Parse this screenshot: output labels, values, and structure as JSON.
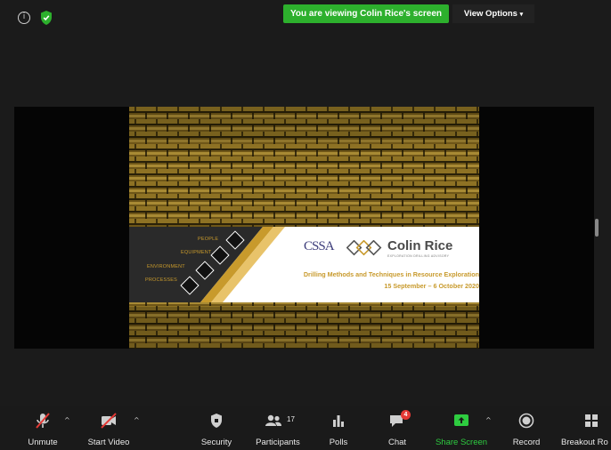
{
  "top_bar": {
    "info_icon": "i",
    "banner_text": "You are viewing Colin Rice's screen",
    "view_options_label": "View Options",
    "view_options_caret": "▾"
  },
  "slide": {
    "pillars": [
      "PEOPLE",
      "EQUIPMENT",
      "ENVIRONMENT",
      "PROCESSES"
    ],
    "logo_left": "CSSA",
    "logo_name": "Colin Rice",
    "logo_subtitle": "EXPLORATION DRILLING ADVISORY",
    "course_title": "Drilling Methods and Techniques in Resource Exploration",
    "dates": "15 September – 6 October 2020"
  },
  "toolbar": {
    "unmute_label": "Unmute",
    "start_video_label": "Start Video",
    "security_label": "Security",
    "participants_label": "Participants",
    "participants_count": "17",
    "polls_label": "Polls",
    "chat_label": "Chat",
    "chat_badge": "4",
    "share_screen_label": "Share Screen",
    "record_label": "Record",
    "breakout_label": "Breakout Ro",
    "caret": "^"
  },
  "colors": {
    "banner_green": "#2db02d",
    "share_green": "#2ecc40",
    "slide_gold": "#c89a2c",
    "badge_red": "#e53935"
  }
}
